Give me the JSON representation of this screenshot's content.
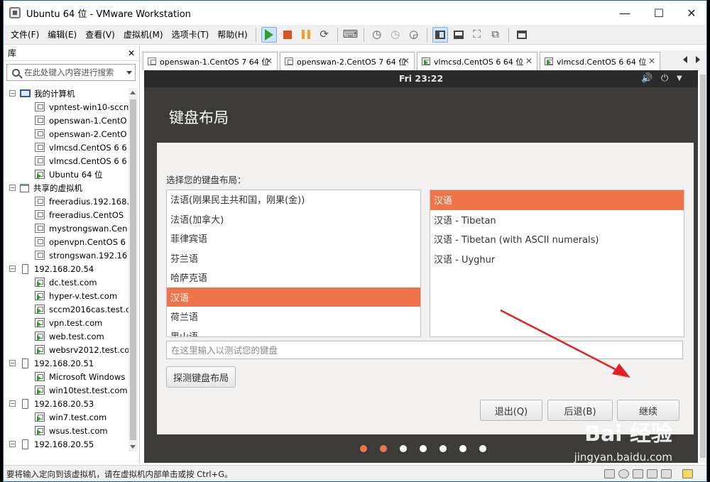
{
  "window": {
    "title": "Ubuntu 64 位 - VMware Workstation",
    "minimize": "—",
    "maximize": "☐",
    "close": "✕"
  },
  "menubar": {
    "items": [
      "文件(F)",
      "编辑(E)",
      "查看(V)",
      "虚拟机(M)",
      "选项卡(T)",
      "帮助(H)"
    ]
  },
  "library": {
    "title": "库",
    "close": "✕",
    "search_placeholder": "在此处键入内容进行搜索",
    "tree": [
      {
        "label": "我的计算机",
        "level": 0,
        "kind": "pc"
      },
      {
        "label": "vpntest-win10-sccn",
        "level": 1,
        "kind": "vm"
      },
      {
        "label": "openswan-1.CentO",
        "level": 1,
        "kind": "vm"
      },
      {
        "label": "openswan-2.CentO",
        "level": 1,
        "kind": "vm"
      },
      {
        "label": "vlmcsd.CentOS 6 6",
        "level": 1,
        "kind": "vm"
      },
      {
        "label": "vlmcsd.CentOS 6 6",
        "level": 1,
        "kind": "vm"
      },
      {
        "label": "Ubuntu 64 位",
        "level": 1,
        "kind": "vm-run"
      },
      {
        "label": "共享的虚拟机",
        "level": 0,
        "kind": "share"
      },
      {
        "label": "freeradius.192.168.",
        "level": 1,
        "kind": "vm"
      },
      {
        "label": "freeradius.CentOS",
        "level": 1,
        "kind": "vm"
      },
      {
        "label": "mystrongswan.Cen",
        "level": 1,
        "kind": "vm"
      },
      {
        "label": "openvpn.CentOS 6",
        "level": 1,
        "kind": "vm"
      },
      {
        "label": "strongswan.192.16",
        "level": 1,
        "kind": "vm"
      },
      {
        "label": "192.168.20.54",
        "level": 0,
        "kind": "host"
      },
      {
        "label": "dc.test.com",
        "level": 1,
        "kind": "vm-run"
      },
      {
        "label": "hyper-v.test.com",
        "level": 1,
        "kind": "vm-run"
      },
      {
        "label": "sccm2016cas.test.c",
        "level": 1,
        "kind": "vm-run"
      },
      {
        "label": "vpn.test.com",
        "level": 1,
        "kind": "vm-run"
      },
      {
        "label": "web.test.com",
        "level": 1,
        "kind": "vm-run"
      },
      {
        "label": "websrv2012.test.co",
        "level": 1,
        "kind": "vm-run"
      },
      {
        "label": "192.168.20.51",
        "level": 0,
        "kind": "host"
      },
      {
        "label": "Microsoft Windows",
        "level": 1,
        "kind": "vm-run"
      },
      {
        "label": "win10test.test.com",
        "level": 1,
        "kind": "vm-run"
      },
      {
        "label": "192.168.20.53",
        "level": 0,
        "kind": "host"
      },
      {
        "label": "win7.test.com",
        "level": 1,
        "kind": "vm-run"
      },
      {
        "label": "wsus.test.com",
        "level": 1,
        "kind": "vm-run"
      },
      {
        "label": "192.168.20.55",
        "level": 0,
        "kind": "host"
      }
    ]
  },
  "tabs": [
    {
      "label": "openswan-1.CentOS 7 64 位"
    },
    {
      "label": "openswan-2.CentOS 7 64 位"
    },
    {
      "label": "vlmcsd.CentOS 6 64 位"
    },
    {
      "label": "vlmcsd.CentOS 6 64 位"
    }
  ],
  "vm": {
    "clock": "Fri 23:22",
    "installer": {
      "title": "键盘布局",
      "prompt": "选择您的键盘布局：",
      "layouts": [
        "法语(刚果民主共和国，刚果(金))",
        "法语(加拿大)",
        "菲律宾语",
        "芬兰语",
        "哈萨克语",
        "汉语",
        "荷兰语",
        "黑山语"
      ],
      "selected_layout": 5,
      "variants": [
        "汉语",
        "汉语 - Tibetan",
        "汉语 - Tibetan (with ASCII numerals)",
        "汉语 - Uyghur"
      ],
      "selected_variant": 0,
      "test_placeholder": "在这里输入以测试您的键盘",
      "detect_button": "探测键盘布局",
      "quit_button": "退出(Q)",
      "back_button": "后退(B)",
      "continue_button": "继续"
    },
    "progress_dots": [
      "#f0744a",
      "#f0744a",
      "#ffffff",
      "#ffffff",
      "#ffffff",
      "#ffffff",
      "#ffffff"
    ]
  },
  "watermark": {
    "brand": "Bai 经验",
    "url": "jingyan.baidu.com"
  },
  "statusbar": {
    "text": "要将输入定向到该虚拟机，请在虚拟机内部单击或按 Ctrl+G。"
  },
  "colors": {
    "accent": "#f0744a",
    "arrow": "#e0231f",
    "ubuntu_dark": "#3c3b37"
  }
}
